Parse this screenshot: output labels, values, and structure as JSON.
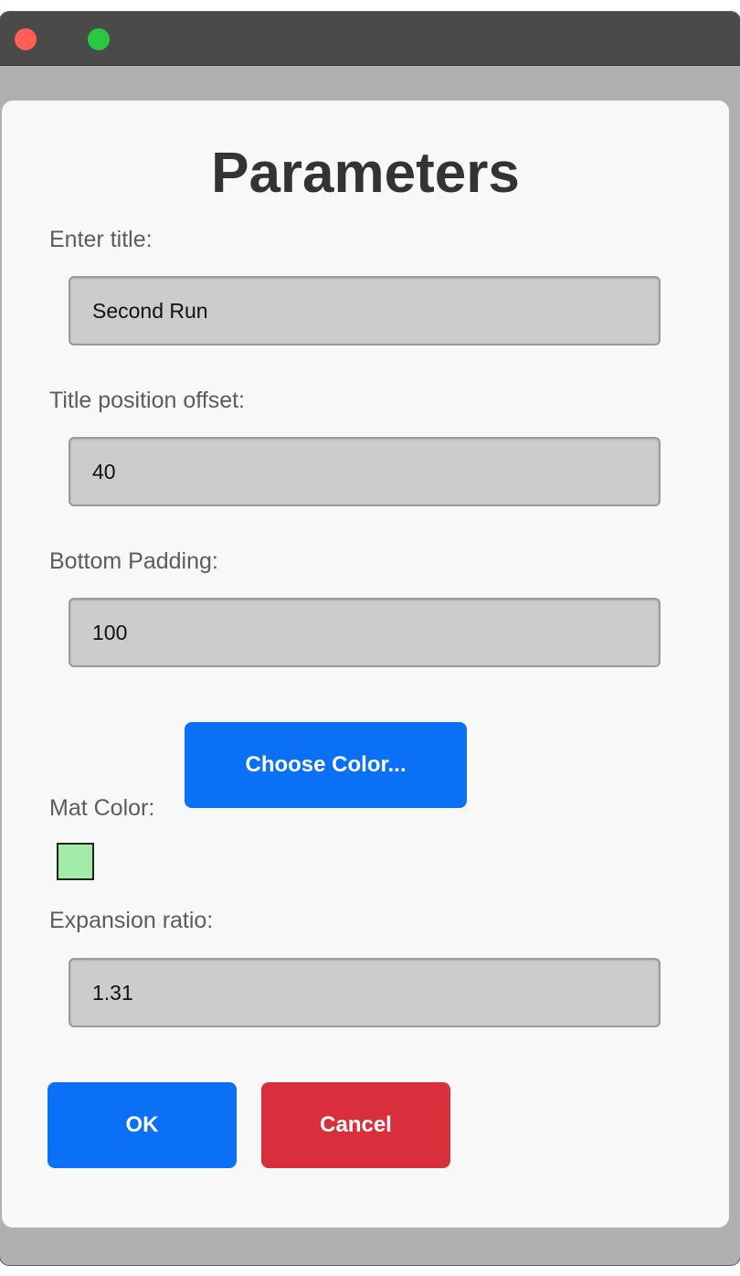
{
  "dialog": {
    "title": "Parameters"
  },
  "fields": {
    "title": {
      "label": "Enter title:",
      "value": "Second Run"
    },
    "title_offset": {
      "label": "Title position offset:",
      "value": "40"
    },
    "bottom_padding": {
      "label": "Bottom Padding:",
      "value": "100"
    },
    "expansion_ratio": {
      "label": "Expansion ratio:",
      "value": "1.31"
    }
  },
  "mat_color": {
    "label": "Mat Color:",
    "button_label": "Choose Color...",
    "swatch_color": "#a3eca7"
  },
  "actions": {
    "ok_label": "OK",
    "cancel_label": "Cancel"
  },
  "colors": {
    "primary": "#0a70f5",
    "danger": "#d92f3c",
    "close_light": "#ff5f57",
    "zoom_light": "#28c840"
  }
}
